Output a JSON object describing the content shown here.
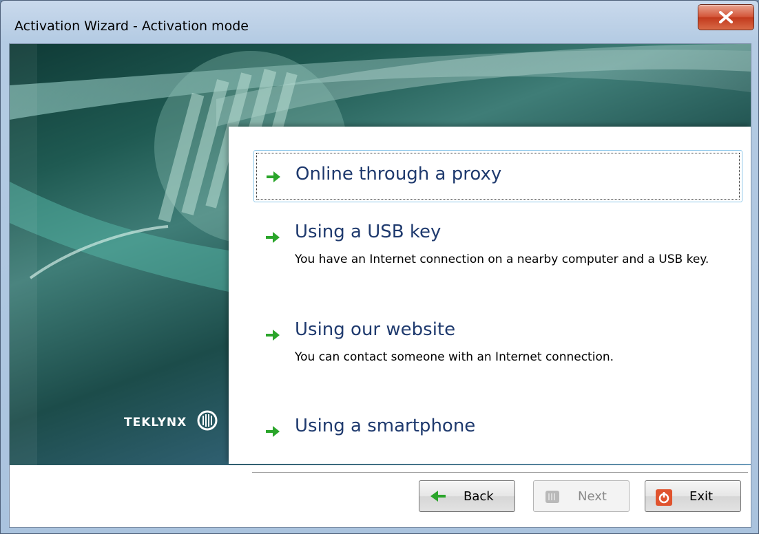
{
  "window": {
    "title": "Activation Wizard - Activation mode",
    "close_glyph": "X"
  },
  "branding": {
    "logo_text": "TEKLYNX"
  },
  "options": [
    {
      "title": "Online through a proxy",
      "description": "",
      "selected": true
    },
    {
      "title": "Using a USB key",
      "description": "You have an Internet connection on a nearby computer and a USB key.",
      "selected": false
    },
    {
      "title": "Using our website",
      "description": "You can contact someone with an Internet connection.",
      "selected": false
    },
    {
      "title": "Using a smartphone",
      "description": "",
      "selected": false
    }
  ],
  "footer": {
    "back_label": "Back",
    "next_label": "Next",
    "exit_label": "Exit"
  },
  "colors": {
    "arrow_green": "#2aa52a",
    "option_title": "#1f3a6e",
    "close_red": "#c23a1d"
  }
}
